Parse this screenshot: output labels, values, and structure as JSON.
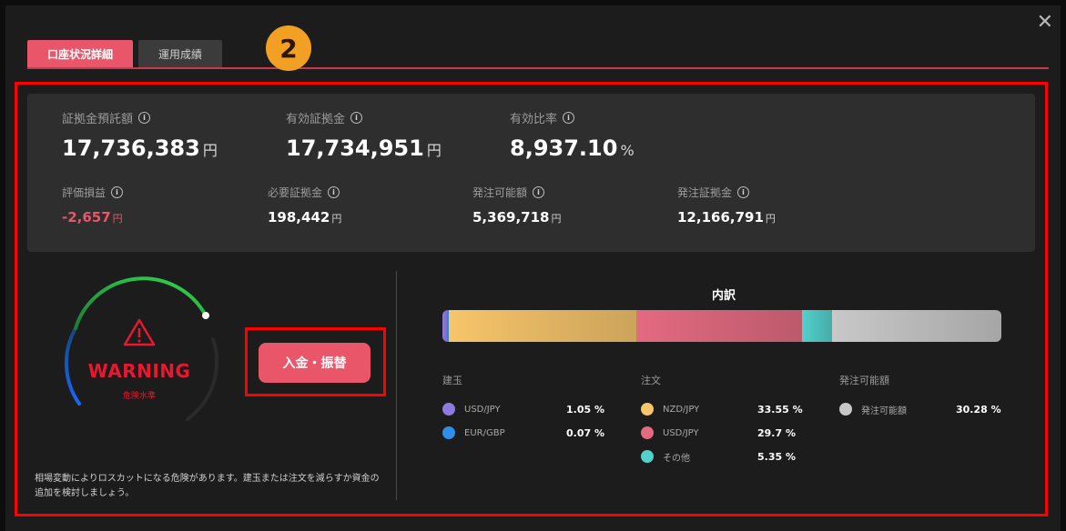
{
  "close_label": "✕",
  "tabs": [
    {
      "label": "口座状況詳細",
      "active": true
    },
    {
      "label": "運用成績",
      "active": false
    }
  ],
  "step_badge": "2",
  "summary": {
    "row1": [
      {
        "label": "証拠金預託額",
        "value": "17,736,383",
        "unit": "円"
      },
      {
        "label": "有効証拠金",
        "value": "17,734,951",
        "unit": "円"
      },
      {
        "label": "有効比率",
        "value": "8,937.10",
        "unit": "%"
      }
    ],
    "row2": [
      {
        "label": "評価損益",
        "value": "-2,657",
        "unit": "円"
      },
      {
        "label": "必要証拠金",
        "value": "198,442",
        "unit": "円"
      },
      {
        "label": "発注可能額",
        "value": "5,369,718",
        "unit": "円"
      },
      {
        "label": "発注証拠金",
        "value": "12,166,791",
        "unit": "円"
      }
    ],
    "info_icon": "ⓘ"
  },
  "warning": {
    "title": "WARNING",
    "subtitle": "危険水準",
    "icon": "warning-triangle-icon",
    "color": "#e8182e"
  },
  "deposit_button": {
    "label": "入金・振替"
  },
  "note": "相場変動によりロスカットになる危険があります。建玉または注文を減らすか資金の追加を検討しましょう。",
  "breakdown": {
    "title": "内訳",
    "segments": [
      {
        "name": "USD/JPY",
        "percent": 1.05,
        "color": "#8f7be0"
      },
      {
        "name": "EUR/GBP",
        "percent": 0.07,
        "color": "#2f8fe8"
      },
      {
        "name": "NZD/JPY",
        "percent": 33.55,
        "color": "#f7c56a"
      },
      {
        "name": "USD/JPY",
        "percent": 29.7,
        "color": "#e36a80"
      },
      {
        "name": "その他",
        "percent": 5.35,
        "color": "#53d0cc"
      },
      {
        "name": "発注可能額",
        "percent": 30.28,
        "color": "#c8c8c8"
      }
    ],
    "groups": [
      {
        "title": "建玉",
        "items": [
          {
            "name": "USD/JPY",
            "value": "1.05 %",
            "color": "#8f7be0"
          },
          {
            "name": "EUR/GBP",
            "value": "0.07 %",
            "color": "#2f8fe8"
          }
        ]
      },
      {
        "title": "注文",
        "items": [
          {
            "name": "NZD/JPY",
            "value": "33.55 %",
            "color": "#f7c56a"
          },
          {
            "name": "USD/JPY",
            "value": "29.7 %",
            "color": "#e36a80"
          },
          {
            "name": "その他",
            "value": "5.35 %",
            "color": "#53d0cc"
          }
        ]
      },
      {
        "title": "発注可能額",
        "items": [
          {
            "name": "発注可能額",
            "value": "30.28 %",
            "color": "#c8c8c8"
          }
        ]
      }
    ]
  }
}
